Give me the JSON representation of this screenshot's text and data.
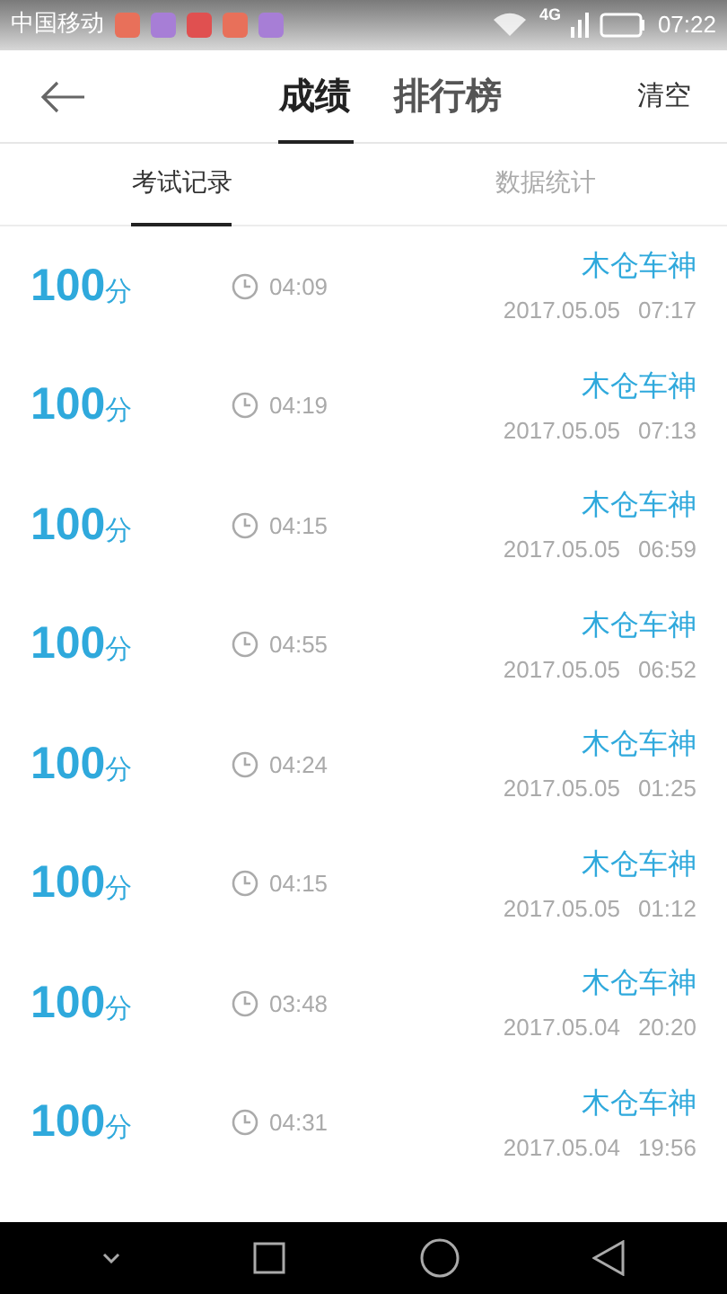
{
  "status_bar": {
    "carrier": "中国移动",
    "notifications": [
      {
        "color": "#e8705a"
      },
      {
        "color": "#a77ed6"
      },
      {
        "color": "#e05050"
      },
      {
        "color": "#e8705a"
      },
      {
        "color": "#a77ed6"
      }
    ],
    "network": "4G",
    "time": "07:22"
  },
  "header": {
    "tabs": [
      {
        "label": "成绩",
        "selected": true
      },
      {
        "label": "排行榜",
        "selected": false
      }
    ],
    "action": "清空"
  },
  "subtabs": [
    {
      "label": "考试记录",
      "selected": true
    },
    {
      "label": "数据统计",
      "selected": false
    }
  ],
  "records": [
    {
      "score": "100",
      "unit": "分",
      "duration": "04:09",
      "name": "木仓车神",
      "date": "2017.05.05",
      "time": "07:17"
    },
    {
      "score": "100",
      "unit": "分",
      "duration": "04:19",
      "name": "木仓车神",
      "date": "2017.05.05",
      "time": "07:13"
    },
    {
      "score": "100",
      "unit": "分",
      "duration": "04:15",
      "name": "木仓车神",
      "date": "2017.05.05",
      "time": "06:59"
    },
    {
      "score": "100",
      "unit": "分",
      "duration": "04:55",
      "name": "木仓车神",
      "date": "2017.05.05",
      "time": "06:52"
    },
    {
      "score": "100",
      "unit": "分",
      "duration": "04:24",
      "name": "木仓车神",
      "date": "2017.05.05",
      "time": "01:25"
    },
    {
      "score": "100",
      "unit": "分",
      "duration": "04:15",
      "name": "木仓车神",
      "date": "2017.05.05",
      "time": "01:12"
    },
    {
      "score": "100",
      "unit": "分",
      "duration": "03:48",
      "name": "木仓车神",
      "date": "2017.05.04",
      "time": "20:20"
    },
    {
      "score": "100",
      "unit": "分",
      "duration": "04:31",
      "name": "木仓车神",
      "date": "2017.05.04",
      "time": "19:56"
    }
  ]
}
